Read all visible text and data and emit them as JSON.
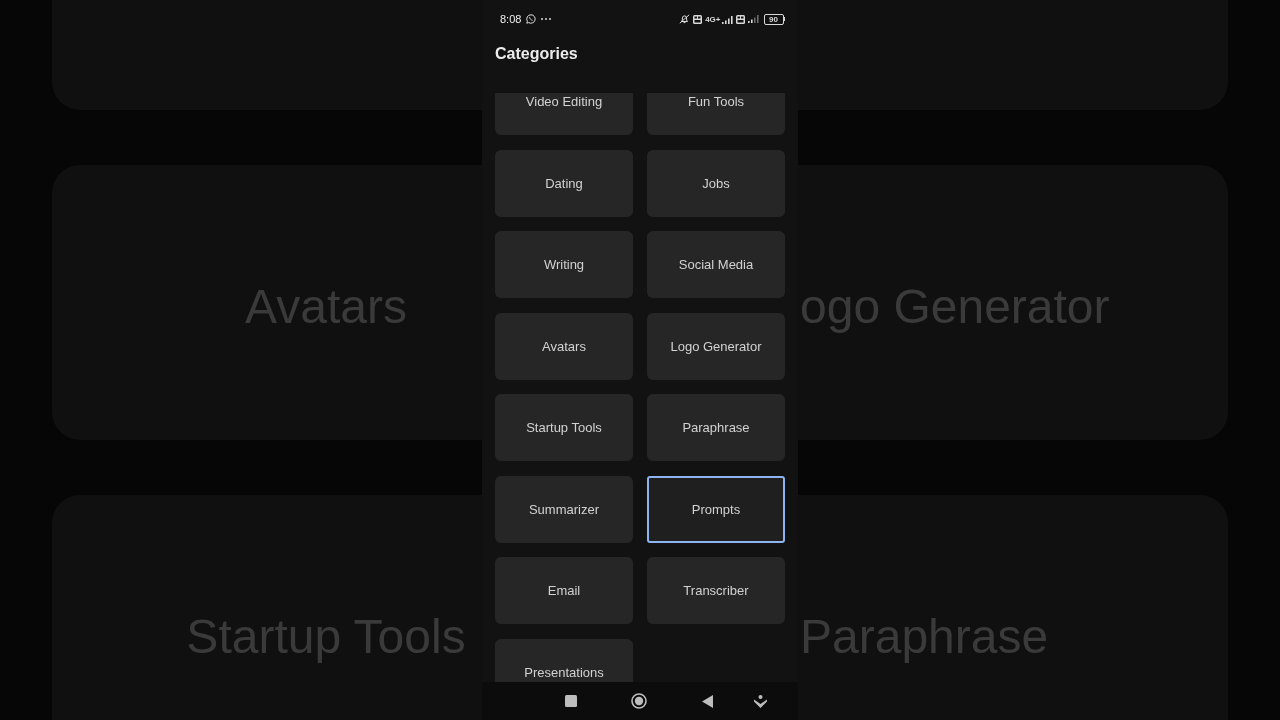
{
  "background": {
    "rows": [
      {
        "left": "Avatars",
        "right": "ogo Generator"
      },
      {
        "left": "Startup Tools",
        "right": "Paraphrase"
      }
    ]
  },
  "status_bar": {
    "time": "8:08",
    "network_type": "4G+",
    "battery": "90"
  },
  "header": {
    "title": "Categories"
  },
  "categories": [
    {
      "label": "Video Editing",
      "selected": false
    },
    {
      "label": "Fun Tools",
      "selected": false
    },
    {
      "label": "Dating",
      "selected": false
    },
    {
      "label": "Jobs",
      "selected": false
    },
    {
      "label": "Writing",
      "selected": false
    },
    {
      "label": "Social Media",
      "selected": false
    },
    {
      "label": "Avatars",
      "selected": false
    },
    {
      "label": "Logo Generator",
      "selected": false
    },
    {
      "label": "Startup Tools",
      "selected": false
    },
    {
      "label": "Paraphrase",
      "selected": false
    },
    {
      "label": "Summarizer",
      "selected": false
    },
    {
      "label": "Prompts",
      "selected": true
    },
    {
      "label": "Email",
      "selected": false
    },
    {
      "label": "Transcriber",
      "selected": false
    },
    {
      "label": "Presentations",
      "selected": false
    }
  ]
}
